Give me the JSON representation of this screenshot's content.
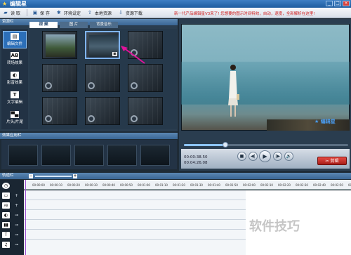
{
  "window": {
    "title": "编辑星",
    "controls": [
      "_",
      "□",
      "×"
    ]
  },
  "menu": [
    {
      "label": "读 取",
      "icon": "folder-open-icon"
    },
    {
      "label": "保 存",
      "icon": "save-icon"
    },
    {
      "label": "环境设定",
      "icon": "gear-icon"
    },
    {
      "label": "本地资源",
      "icon": "upload-icon"
    },
    {
      "label": "资源下载",
      "icon": "download-icon"
    }
  ],
  "notice": "新一代产品编辑星V3来了! 您想要的图示时间特效，自动，速度，全新解析在这里!",
  "resource_panel": {
    "header": "资源栏",
    "tabs": [
      "视 频",
      "图 片",
      "背景音乐"
    ],
    "active_tab": "视 频",
    "side_buttons": [
      {
        "label": "编辑文件",
        "icon": "file-edit-icon",
        "active": true
      },
      {
        "label": "转场效果",
        "icon": "ab-transition-icon",
        "active": false
      },
      {
        "label": "影音效果",
        "icon": "effect-icon",
        "active": false
      },
      {
        "label": "文字编辑",
        "icon": "text-t-icon",
        "active": false
      },
      {
        "label": "片头/片尾",
        "icon": "intro-outro-icon",
        "active": false
      }
    ]
  },
  "effects_panel": {
    "header": "效果应用栏"
  },
  "player": {
    "watermark": "编辑星",
    "time_current": "00:00:38.50",
    "time_total": "00:04:26.08",
    "progress": 0.25,
    "buttons": [
      "■",
      "◀|",
      "▶",
      "|▶",
      "🔊"
    ],
    "save_label": "剪辑"
  },
  "timeline": {
    "header": "轨道栏",
    "zoom_minus": "−",
    "zoom_plus": "+",
    "ticks": [
      "00:00:00",
      "00:00:10",
      "00:00:20",
      "00:00:30",
      "00:00:40",
      "00:00:50",
      "00:01:00",
      "00:01:10",
      "00:01:20",
      "00:01:30",
      "00:01:40",
      "00:01:50",
      "00:02:00",
      "00:02:10",
      "00:02:20",
      "00:02:30",
      "00:02:40",
      "00:02:50",
      "00:03:00"
    ],
    "tracks": [
      {
        "name": "clock-track-icon",
        "glyph": "◷"
      },
      {
        "name": "video-track-icon",
        "glyph": "▭"
      },
      {
        "name": "transition-track-icon",
        "glyph": "AB"
      },
      {
        "name": "effect-track-icon",
        "glyph": "◐"
      },
      {
        "name": "text-track-icon",
        "glyph": "T"
      },
      {
        "name": "music-track-icon",
        "glyph": "♫"
      }
    ]
  },
  "page_watermark": "软件技巧"
}
